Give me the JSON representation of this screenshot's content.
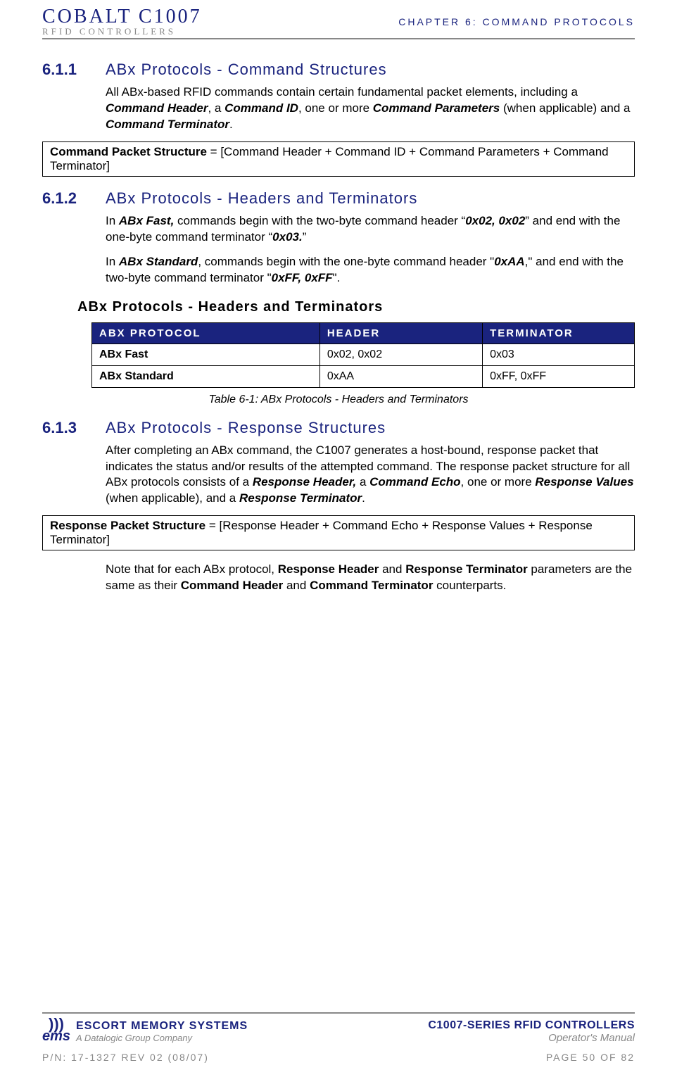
{
  "header": {
    "logo_top": "COBALT  C1007",
    "logo_sub": "RFID CONTROLLERS",
    "chapter": "CHAPTER 6: COMMAND PROTOCOLS"
  },
  "sections": {
    "s611": {
      "num": "6.1.1",
      "title": "ABx Protocols - Command Structures",
      "p1_a": "All ABx-based RFID commands contain certain fundamental packet elements, including a ",
      "p1_b": "Command Header",
      "p1_c": ", a ",
      "p1_d": "Command ID",
      "p1_e": ", one or more ",
      "p1_f": "Command Parameters",
      "p1_g": " (when applicable) and a ",
      "p1_h": "Command Terminator",
      "p1_i": ".",
      "box_a": "Command Packet Structure",
      "box_b": " = [Command Header + Command ID + Command Parameters + Command Terminator]"
    },
    "s612": {
      "num": "6.1.2",
      "title": "ABx Protocols - Headers and Terminators",
      "p1_a": "In ",
      "p1_b": "ABx Fast,",
      "p1_c": " commands begin with the two-byte command header “",
      "p1_d": "0x02, 0x02",
      "p1_e": "” and end with the one-byte command terminator “",
      "p1_f": "0x03.",
      "p1_g": "”",
      "p2_a": "In ",
      "p2_b": "ABx Standard",
      "p2_c": ", commands begin with the one-byte command header \"",
      "p2_d": "0xAA",
      "p2_e": ",\" and end with the two-byte command terminator \"",
      "p2_f": "0xFF, 0xFF",
      "p2_g": "\"."
    },
    "table": {
      "subhead": "ABx Protocols - Headers and Terminators",
      "h1": "ABX PROTOCOL",
      "h2": "HEADER",
      "h3": "TERMINATOR",
      "r1c1": "ABx Fast",
      "r1c2": "0x02, 0x02",
      "r1c3": "0x03",
      "r2c1": "ABx Standard",
      "r2c2": "0xAA",
      "r2c3": "0xFF, 0xFF",
      "caption": "Table 6-1: ABx Protocols - Headers and Terminators"
    },
    "s613": {
      "num": "6.1.3",
      "title": "ABx Protocols - Response Structures",
      "p1_a": "After completing an ABx command, the C1007 generates a host-bound, response packet that indicates the status and/or results of the attempted command. The response packet structure for all ABx protocols consists of a ",
      "p1_b": "Response Header,",
      "p1_c": " a ",
      "p1_d": "Command Echo",
      "p1_e": ", one or more ",
      "p1_f": "Response Values",
      "p1_g": " (when applicable), and a ",
      "p1_h": "Response Terminator",
      "p1_i": ".",
      "box_a": "Response Packet Structure",
      "box_b": " = [Response Header + Command Echo + Response Values + Response Terminator]",
      "p2_a": "Note that for each ABx protocol, ",
      "p2_b": "Response Header",
      "p2_c": " and ",
      "p2_d": "Response Terminator",
      "p2_e": " parameters are the same as their ",
      "p2_f": "Command Header",
      "p2_g": " and ",
      "p2_h": "Command Terminator",
      "p2_i": " counterparts."
    }
  },
  "footer": {
    "escort": "ESCORT MEMORY SYSTEMS",
    "datalogic": "A Datalogic Group Company",
    "ems": "ems",
    "c1007": "C1007-SERIES RFID CONTROLLERS",
    "opman": "Operator's Manual",
    "pn": "P/N: 17-1327 REV 02 (08/07)",
    "page": "PAGE 50 OF 82"
  }
}
